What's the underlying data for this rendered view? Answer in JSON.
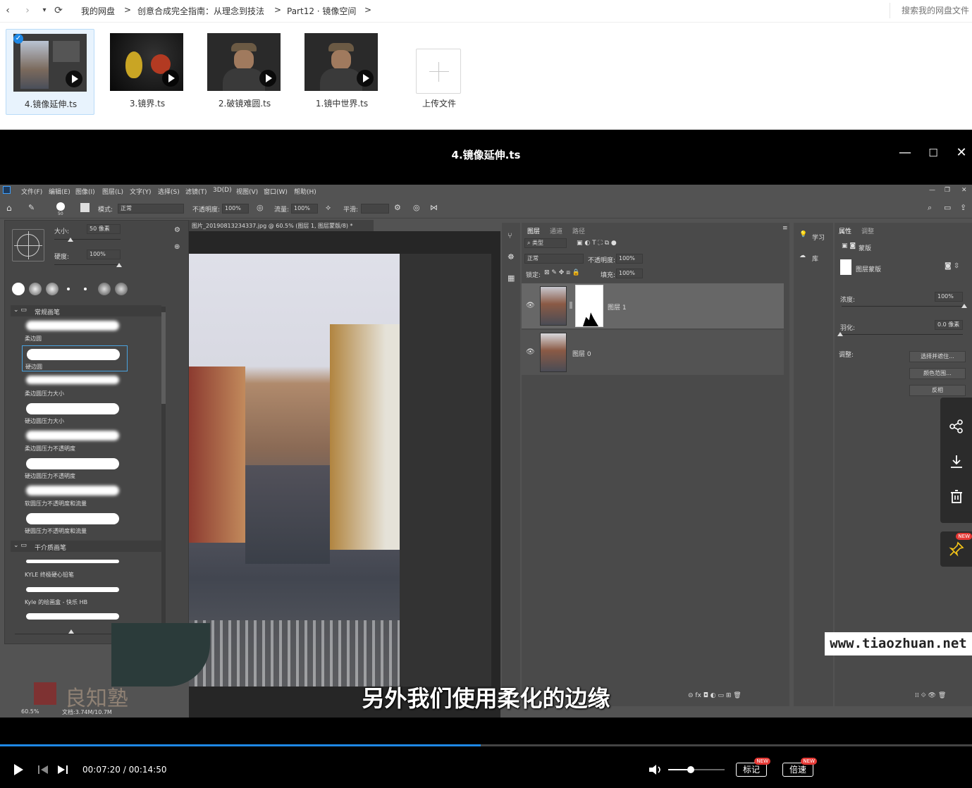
{
  "nav": {
    "back": "‹",
    "forward": "›",
    "dropdown": "▾",
    "refresh": "⟳"
  },
  "breadcrumb": [
    "我的网盘",
    "创意合成完全指南：从理念到技法",
    "Part12 · 镜像空间"
  ],
  "breadcrumb_sep": ">",
  "search_placeholder": "搜索我的网盘文件",
  "files": [
    {
      "name": "4.镜像延伸.ts",
      "selected": true
    },
    {
      "name": "3.镜界.ts",
      "selected": false
    },
    {
      "name": "2.破镜难圆.ts",
      "selected": false
    },
    {
      "name": "1.镜中世界.ts",
      "selected": false
    }
  ],
  "upload_label": "上传文件",
  "player": {
    "title": "4.镜像延伸.ts",
    "subtitle": "另外我们使用柔化的边缘",
    "time_current": "00:07:20",
    "time_sep": " / ",
    "time_total": "00:14:50",
    "progress": 0.4944,
    "volume": 0.4,
    "mark_label": "标记",
    "speed_label": "倍速",
    "new_badge": "NEW",
    "watermark_url": "www.tiaozhuan.net",
    "watermark_brand": "良知塾"
  },
  "photoshop": {
    "menus": [
      "文件(F)",
      "编辑(E)",
      "图像(I)",
      "图层(L)",
      "文字(Y)",
      "选择(S)",
      "滤镜(T)",
      "3D(D)",
      "视图(V)",
      "窗口(W)",
      "帮助(H)"
    ],
    "options": {
      "brush_size_badge": "50",
      "mode_label": "模式:",
      "mode_value": "正常",
      "opacity_label": "不透明度:",
      "opacity_value": "100%",
      "flow_label": "流量:",
      "flow_value": "100%",
      "smooth_label": "平滑:"
    },
    "brush_panel": {
      "size_label": "大小:",
      "size_value": "50 像素",
      "hardness_label": "硬度:",
      "hardness_value": "100%",
      "group1": "常规画笔",
      "group2": "干介质画笔",
      "brushes": [
        "柔边圆",
        "硬边圆",
        "柔边圆压力大小",
        "硬边圆压力大小",
        "柔边圆压力不透明度",
        "硬边圆压力不透明度",
        "软圆压力不透明度和流量",
        "硬圆压力不透明度和流量"
      ],
      "dry_brushes": [
        "KYLE 终极硬心铅笔",
        "Kyle 的绘画盒 - 快乐 HB"
      ]
    },
    "doc_tab": "图片_20190813234337.jpg @ 60.5% (图层 1, 图层蒙版/8) *",
    "status_zoom": "60.5%",
    "status_doc": "文档:3.74M/10.7M",
    "layers": {
      "tabs": [
        "图层",
        "通道",
        "路径"
      ],
      "filter_label": "类型",
      "blend_mode": "正常",
      "opacity_label": "不透明度:",
      "opacity_value": "100%",
      "lock_label": "锁定:",
      "fill_label": "填充:",
      "fill_value": "100%",
      "items": [
        "图层 1",
        "图层 0"
      ]
    },
    "learn": {
      "learn_label": "学习",
      "library_label": "库"
    },
    "properties": {
      "tabs": [
        "属性",
        "调整"
      ],
      "mask_title": "蒙版",
      "layer_mask": "图层蒙版",
      "density_label": "浓度:",
      "density_value": "100%",
      "feather_label": "羽化:",
      "feather_value": "0.0 像素",
      "adjust_label": "调整:",
      "btn_select": "选择并遮住...",
      "btn_color": "颜色范围...",
      "btn_invert": "反相"
    }
  },
  "icons": {
    "share": "share-icon",
    "download": "download-icon",
    "delete": "trash-icon",
    "pin": "pin-icon"
  }
}
